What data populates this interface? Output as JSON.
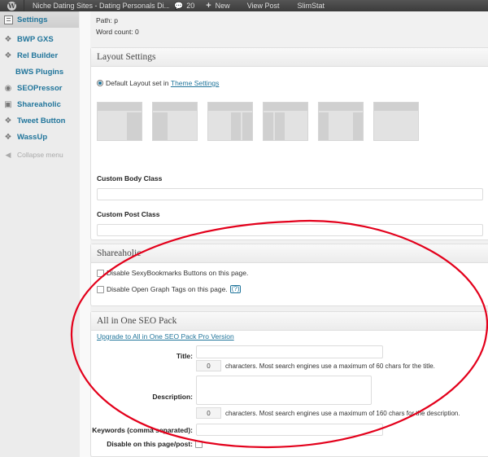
{
  "adminbar": {
    "site_name": "Niche Dating Sites - Dating Personals Di...",
    "comments_count": "20",
    "new_label": "New",
    "view_post_label": "View Post",
    "slimstat_label": "SlimStat"
  },
  "sidebar": {
    "items": [
      {
        "label": "Settings",
        "icon": "settings-icon"
      },
      {
        "label": "BWP GXS",
        "icon": "plugin-icon"
      },
      {
        "label": "Rel Builder",
        "icon": "plugin-icon"
      },
      {
        "label": "BWS Plugins",
        "icon": ""
      },
      {
        "label": "SEOPressor",
        "icon": "plugin-icon"
      },
      {
        "label": "Shareaholic",
        "icon": "plugin-icon"
      },
      {
        "label": "Tweet Button",
        "icon": "plugin-icon"
      },
      {
        "label": "WassUp",
        "icon": "plugin-icon"
      }
    ],
    "collapse_label": "Collapse menu"
  },
  "editor": {
    "path": "Path: p",
    "word_count": "Word count: 0"
  },
  "layout_settings": {
    "title": "Layout Settings",
    "default_text": "Default Layout set in",
    "theme_link": "Theme Settings",
    "custom_body_label": "Custom Body Class",
    "custom_post_label": "Custom Post Class"
  },
  "shareaholic": {
    "title": "Shareaholic",
    "disable_buttons": "Disable SexyBookmarks Buttons on this page.",
    "disable_og": "Disable Open Graph Tags on this page.",
    "help": "(?)"
  },
  "aioseo": {
    "title": "All in One SEO Pack",
    "upgrade_link": "Upgrade to All in One SEO Pack Pro Version",
    "title_label": "Title:",
    "title_counter": "0",
    "title_hint": "characters. Most search engines use a maximum of 60 chars for the title.",
    "description_label": "Description:",
    "description_counter": "0",
    "description_hint": "characters. Most search engines use a maximum of 160 chars for the description.",
    "keywords_label": "Keywords (comma separated):",
    "disable_label": "Disable on this page/post:"
  },
  "colors": {
    "link": "#21759b",
    "annotation": "#e3001b",
    "adminbar": "#464646"
  }
}
